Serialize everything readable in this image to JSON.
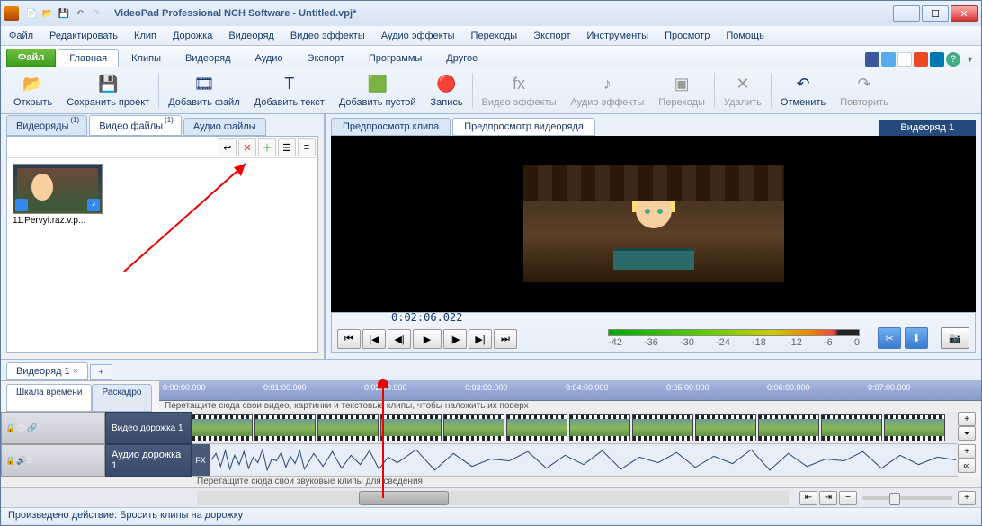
{
  "title": "VideoPad Professional NCH Software - Untitled.vpj*",
  "menu": [
    "Файл",
    "Редактировать",
    "Клип",
    "Дорожка",
    "Видеоряд",
    "Видео эффекты",
    "Аудио эффекты",
    "Переходы",
    "Экспорт",
    "Инструменты",
    "Просмотр",
    "Помощь"
  ],
  "ribbon": {
    "file": "Файл",
    "tabs": [
      "Главная",
      "Клипы",
      "Видеоряд",
      "Аудио",
      "Экспорт",
      "Программы",
      "Другое"
    ],
    "active": 0,
    "btns": [
      {
        "l": "Открыть",
        "i": "📂"
      },
      {
        "l": "Сохранить проект",
        "i": "💾"
      },
      {
        "l": "Добавить файл",
        "i": "🎞"
      },
      {
        "l": "Добавить текст",
        "i": "T"
      },
      {
        "l": "Добавить пустой",
        "i": "🟩"
      },
      {
        "l": "Запись",
        "i": "🔴"
      },
      {
        "l": "Видео эффекты",
        "i": "fx",
        "d": 1
      },
      {
        "l": "Аудио эффекты",
        "i": "♪",
        "d": 1
      },
      {
        "l": "Переходы",
        "i": "▣",
        "d": 1
      },
      {
        "l": "Удалить",
        "i": "✕",
        "d": 1
      },
      {
        "l": "Отменить",
        "i": "↶"
      },
      {
        "l": "Повторить",
        "i": "↷",
        "d": 1
      }
    ]
  },
  "pane": {
    "tabs": [
      "Видеоряды",
      "Видео файлы",
      "Аудио файлы"
    ],
    "counts": [
      "(1)",
      "(1)",
      ""
    ],
    "active": 1,
    "clip": "11.Pervyi.raz.v.p..."
  },
  "preview": {
    "tabs": [
      "Предпросмотр клипа",
      "Предпросмотр видеоряда"
    ],
    "active": 1,
    "label": "Видеоряд 1",
    "timecode": "0:02:06.022",
    "vu": [
      "-42",
      "-36",
      "-30",
      "-24",
      "-18",
      "-12",
      "-6",
      "0"
    ]
  },
  "sequence": {
    "tab": "Видеоряд 1"
  },
  "timeline": {
    "tabs": [
      "Шкала времени",
      "Раскадро"
    ],
    "marks": [
      "0:00:00.000",
      "0:01:00.000",
      "0:02:00.000",
      "0:03:00.000",
      "0:04:00.000",
      "0:05:00.000",
      "0:06:00.000",
      "0:07:00.000"
    ],
    "hint1": "Перетащите сюда свои видео, картинки и текстовые клипы, чтобы наложить их поверх",
    "hint2": "Перетащите сюда свои звуковые клипы для сведения",
    "vtrack": "Видео дорожка 1",
    "atrack": "Аудио дорожка 1",
    "fx": "FX"
  },
  "status": "Произведено действие: Бросить клипы на дорожку"
}
